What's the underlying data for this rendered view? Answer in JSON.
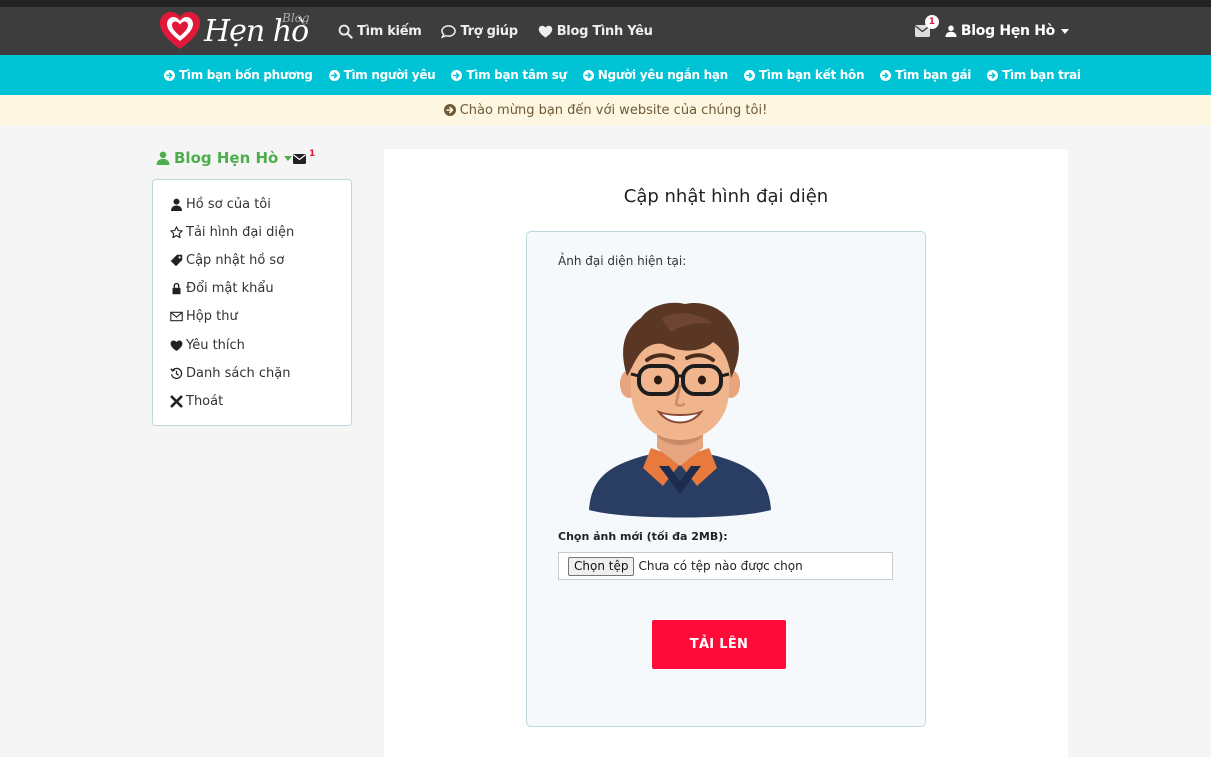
{
  "brand": {
    "logo_text": "Hẹn hò",
    "logo_sup": "Blog"
  },
  "topnav": {
    "items": [
      {
        "label": "Tìm kiếm",
        "icon": "search-icon"
      },
      {
        "label": "Trợ giúp",
        "icon": "chat-icon"
      },
      {
        "label": "Blog Tình Yêu",
        "icon": "heart-icon"
      }
    ],
    "mail_badge": "1",
    "user_label": "Blog Hẹn Hò"
  },
  "subnav": {
    "items": [
      "Tìm bạn bốn phương",
      "Tìm người yêu",
      "Tìm bạn tâm sự",
      "Người yêu ngắn hạn",
      "Tìm bạn kết hôn",
      "Tìm bạn gái",
      "Tìm bạn trai"
    ]
  },
  "welcome": {
    "text": "Chào mừng bạn đến với website của chúng tôi!"
  },
  "sidebar": {
    "title": "Blog Hẹn Hò",
    "mail_count": "1",
    "items": [
      {
        "label": "Hồ sơ của tôi",
        "icon": "user-icon"
      },
      {
        "label": "Tải hình đại diện",
        "icon": "star-icon"
      },
      {
        "label": "Cập nhật hồ sơ",
        "icon": "tag-icon"
      },
      {
        "label": "Đổi mật khẩu",
        "icon": "lock-icon"
      },
      {
        "label": "Hộp thư",
        "icon": "envelope-icon"
      },
      {
        "label": "Yêu thích",
        "icon": "heart-icon"
      },
      {
        "label": "Danh sách chặn",
        "icon": "history-icon"
      },
      {
        "label": "Thoát",
        "icon": "close-icon"
      }
    ]
  },
  "main": {
    "title": "Cập nhật hình đại diện",
    "current_label": "Ảnh đại diện hiện tại:",
    "new_label": "Chọn ảnh mới (tối đa 2MB):",
    "file_button": "Chọn tệp",
    "file_status": "Chưa có tệp nào được chọn",
    "upload_button": "TẢI LÊN"
  },
  "colors": {
    "navbar": "#3d3d3d",
    "subnav": "#00c3d6",
    "accent_green": "#4cae4c",
    "upload": "#ff0b3a"
  }
}
